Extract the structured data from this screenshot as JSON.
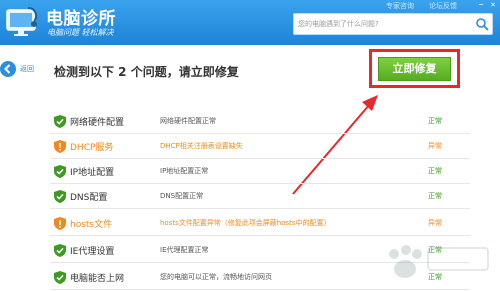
{
  "header": {
    "title": "电脑诊所",
    "slogan": "电脑问题 轻松解决",
    "top_links": [
      "专家咨询",
      "论坛反馈"
    ],
    "min_label": "−",
    "close_label": "×",
    "search": {
      "placeholder": "您的电脑遇到了什么问题?"
    },
    "colors": {
      "header_blue": "#2a8fe0"
    }
  },
  "back": {
    "label": "返回"
  },
  "result_title": "检测到以下 2 个问题，请立即修复",
  "fix_button": {
    "label": "立即修复",
    "highlight_color": "#e8282b",
    "button_color": "#5fb827"
  },
  "items": [
    {
      "name": "网络硬件配置",
      "desc": "网络硬件配置正常",
      "status": "正常",
      "state": "ok"
    },
    {
      "name": "DHCP服务",
      "desc": "DHCP相关注册表设置缺失",
      "status": "异常",
      "state": "warn"
    },
    {
      "name": "IP地址配置",
      "desc": "IP地址配置正常",
      "status": "正常",
      "state": "ok"
    },
    {
      "name": "DNS配置",
      "desc": "DNS配置正常",
      "status": "正常",
      "state": "ok"
    },
    {
      "name": "hosts文件",
      "desc": "hosts文件配置异常（修复此项会屏蔽hosts中的配置）",
      "status": "异常",
      "state": "warn"
    },
    {
      "name": "IE代理设置",
      "desc": "IE代理配置正常",
      "status": "正常",
      "state": "ok"
    },
    {
      "name": "电脑能否上网",
      "desc": "您的电脑可以正常，流畅地访问网页",
      "status": "正常",
      "state": "ok"
    }
  ]
}
